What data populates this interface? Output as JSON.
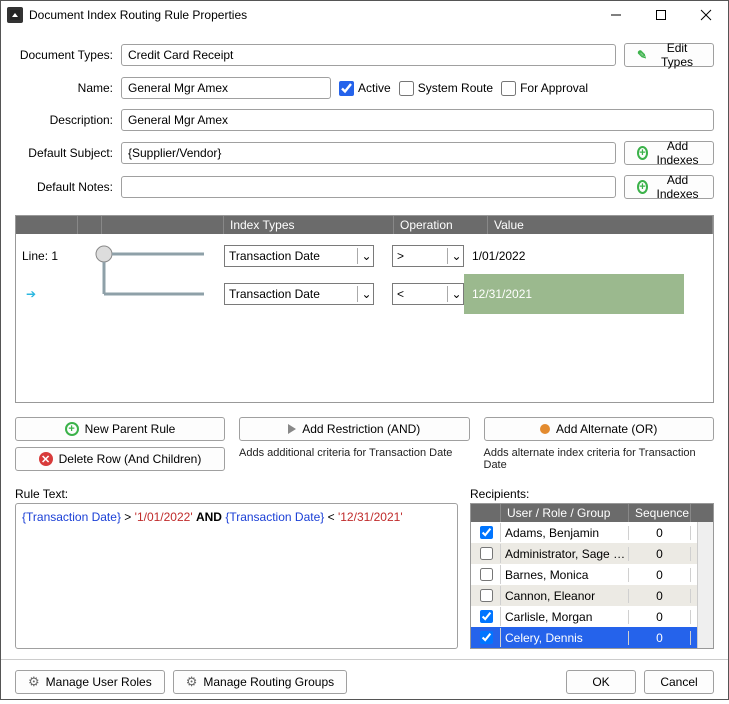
{
  "title": "Document Index Routing Rule Properties",
  "form": {
    "document_types_label": "Document Types:",
    "document_types_value": "Credit Card Receipt",
    "edit_types_label": "Edit Types",
    "name_label": "Name:",
    "name_value": "General Mgr Amex",
    "active_label": "Active",
    "active_checked": true,
    "system_route_label": "System Route",
    "system_route_checked": false,
    "for_approval_label": "For Approval",
    "for_approval_checked": false,
    "description_label": "Description:",
    "description_value": "General Mgr Amex",
    "default_subject_label": "Default Subject:",
    "default_subject_value": "{Supplier/Vendor}",
    "add_indexes_label": "Add Indexes",
    "default_notes_label": "Default Notes:",
    "default_notes_value": ""
  },
  "grid": {
    "headers": {
      "index_types": "Index Types",
      "operation": "Operation",
      "value": "Value"
    },
    "line_label": "Line: 1",
    "rows": [
      {
        "index_type": "Transaction Date",
        "operation": ">",
        "value": "1/01/2022",
        "selected": false
      },
      {
        "index_type": "Transaction Date",
        "operation": "<",
        "value": "12/31/2021",
        "selected": true
      }
    ]
  },
  "actions": {
    "new_parent_label": "New Parent Rule",
    "delete_row_label": "Delete Row (And Children)",
    "add_restriction_label": "Add Restriction (AND)",
    "add_restriction_hint": "Adds additional criteria for Transaction Date",
    "add_alternate_label": "Add Alternate (OR)",
    "add_alternate_hint": "Adds alternate index criteria for Transaction Date"
  },
  "rule_text": {
    "label": "Rule Text:",
    "f1": "{Transaction Date}",
    "op1": ">",
    "v1": "'1/01/2022'",
    "and": "AND",
    "f2": "{Transaction Date}",
    "op2": "<",
    "v2": "'12/31/2021'"
  },
  "recipients": {
    "label": "Recipients:",
    "headers": {
      "user": "User / Role / Group",
      "sequence": "Sequence"
    },
    "rows": [
      {
        "checked": true,
        "name": "Adams, Benjamin",
        "seq": "0",
        "alt": false,
        "sel": false
      },
      {
        "checked": false,
        "name": "Administrator, Sage Pa..",
        "seq": "0",
        "alt": true,
        "sel": false
      },
      {
        "checked": false,
        "name": "Barnes, Monica",
        "seq": "0",
        "alt": false,
        "sel": false
      },
      {
        "checked": false,
        "name": "Cannon, Eleanor",
        "seq": "0",
        "alt": true,
        "sel": false
      },
      {
        "checked": true,
        "name": "Carlisle, Morgan",
        "seq": "0",
        "alt": false,
        "sel": false
      },
      {
        "checked": true,
        "name": "Celery, Dennis",
        "seq": "0",
        "alt": true,
        "sel": true
      }
    ]
  },
  "footer": {
    "manage_user_roles": "Manage User Roles",
    "manage_routing_groups": "Manage Routing Groups",
    "ok": "OK",
    "cancel": "Cancel"
  }
}
